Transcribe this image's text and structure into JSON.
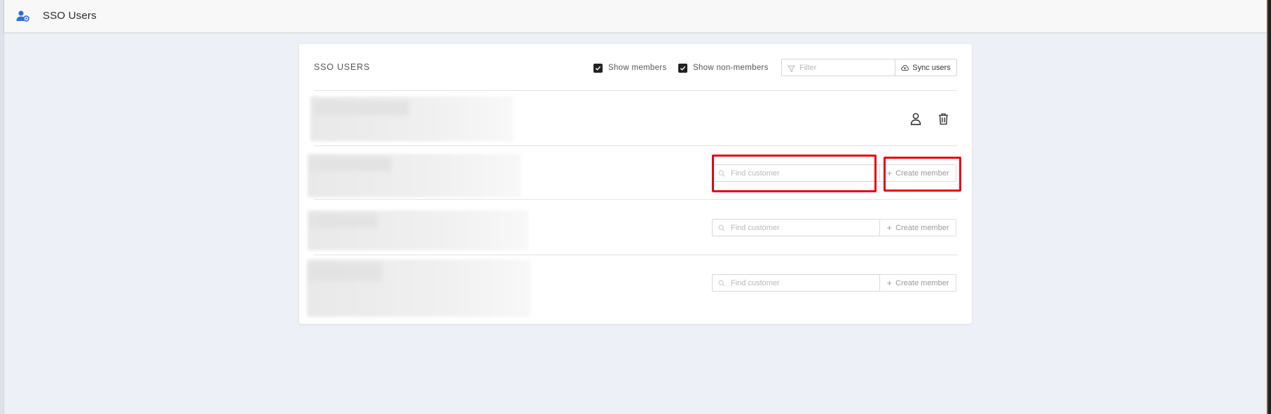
{
  "header": {
    "title": "SSO Users",
    "icon": "user-settings-icon"
  },
  "card": {
    "title": "SSO USERS",
    "show_members": {
      "label": "Show members",
      "checked": true
    },
    "show_non_members": {
      "label": "Show non-members",
      "checked": true
    },
    "filter": {
      "placeholder": "Filter",
      "icon": "filter-icon"
    },
    "sync_button": {
      "label": "Sync users",
      "icon": "cloud-upload-icon"
    }
  },
  "rows": [
    {
      "type": "member",
      "actions": [
        "user-icon",
        "trash-icon"
      ]
    },
    {
      "type": "non-member",
      "find_placeholder": "Find customer",
      "create_label": "Create member"
    },
    {
      "type": "non-member",
      "find_placeholder": "Find customer",
      "create_label": "Create member"
    },
    {
      "type": "non-member",
      "find_placeholder": "Find customer",
      "create_label": "Create member"
    }
  ],
  "colors": {
    "accent": "#2f6fd6",
    "highlight": "#e30613",
    "background": "#eef0f7"
  }
}
